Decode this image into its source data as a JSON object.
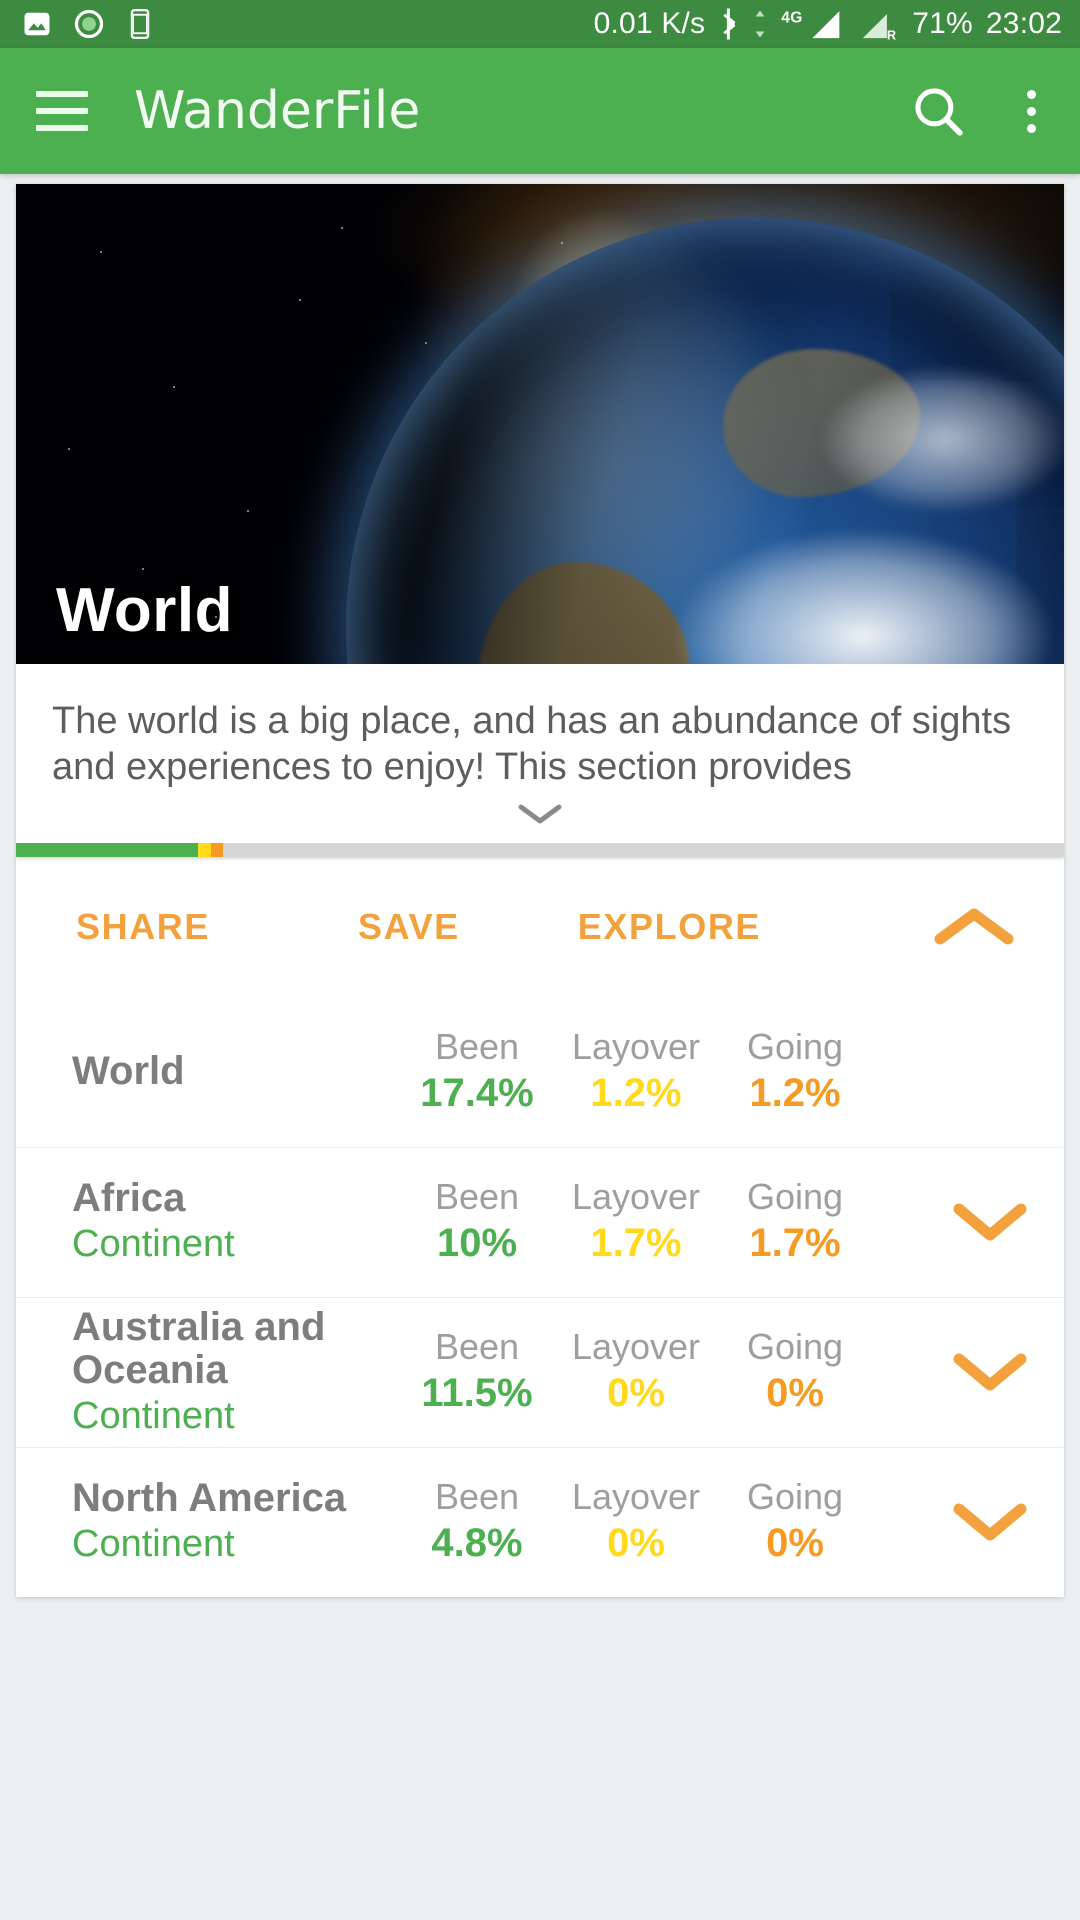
{
  "status_bar": {
    "icons_left": [
      "image-icon",
      "record-icon",
      "screen-rotate-icon"
    ],
    "network_speed": "0.01 K/s",
    "bluetooth": "bluetooth-icon",
    "data_arrows": "data-transfer-icon",
    "signal_1": "4G",
    "signal_2_label": "R",
    "battery": "71%",
    "time": "23:02"
  },
  "app_bar": {
    "menu_icon": "hamburger-menu-icon",
    "title": "WanderFile",
    "search_icon": "search-icon",
    "overflow_icon": "more-options-icon"
  },
  "hero": {
    "title": "World",
    "image_alt": "earth-from-space"
  },
  "description": {
    "text": "The world is a big place, and has an abundance of sights and experiences to enjoy! This section provides",
    "expand_icon": "chevron-down-icon"
  },
  "progress": {
    "segments": [
      {
        "name": "been",
        "percent": 17.4,
        "color": "#4caf50"
      },
      {
        "name": "layover",
        "percent": 1.2,
        "color": "#ffd91a"
      },
      {
        "name": "going",
        "percent": 1.2,
        "color": "#f59a23"
      },
      {
        "name": "remaining",
        "percent": 80.2,
        "color": "#d6d6d6"
      }
    ]
  },
  "actions": {
    "share": "SHARE",
    "save": "SAVE",
    "explore": "EXPLORE",
    "collapse_icon": "chevron-up-icon"
  },
  "colors": {
    "primary_green": "#4caf50",
    "status_bar_green": "#3d8b40",
    "accent_orange": "#f3a13c",
    "been_green": "#4caf50",
    "layover_yellow": "#ffd91a",
    "going_orange": "#f59a23",
    "label_gray": "#9e9e9e",
    "title_gray": "#7d7d7d"
  },
  "stat_labels": {
    "been": "Been",
    "layover": "Layover",
    "going": "Going"
  },
  "rows": [
    {
      "title": "World",
      "subtitle": "",
      "been": "17.4%",
      "layover": "1.2%",
      "going": "1.2%",
      "has_chevron": false,
      "chevron_icon": ""
    },
    {
      "title": "Africa",
      "subtitle": "Continent",
      "been": "10%",
      "layover": "1.7%",
      "going": "1.7%",
      "has_chevron": true,
      "chevron_icon": "chevron-down-icon"
    },
    {
      "title": "Australia and Oceania",
      "subtitle": "Continent",
      "been": "11.5%",
      "layover": "0%",
      "going": "0%",
      "has_chevron": true,
      "chevron_icon": "chevron-down-icon"
    },
    {
      "title": "North America",
      "subtitle": "Continent",
      "been": "4.8%",
      "layover": "0%",
      "going": "0%",
      "has_chevron": true,
      "chevron_icon": "chevron-down-icon"
    }
  ]
}
